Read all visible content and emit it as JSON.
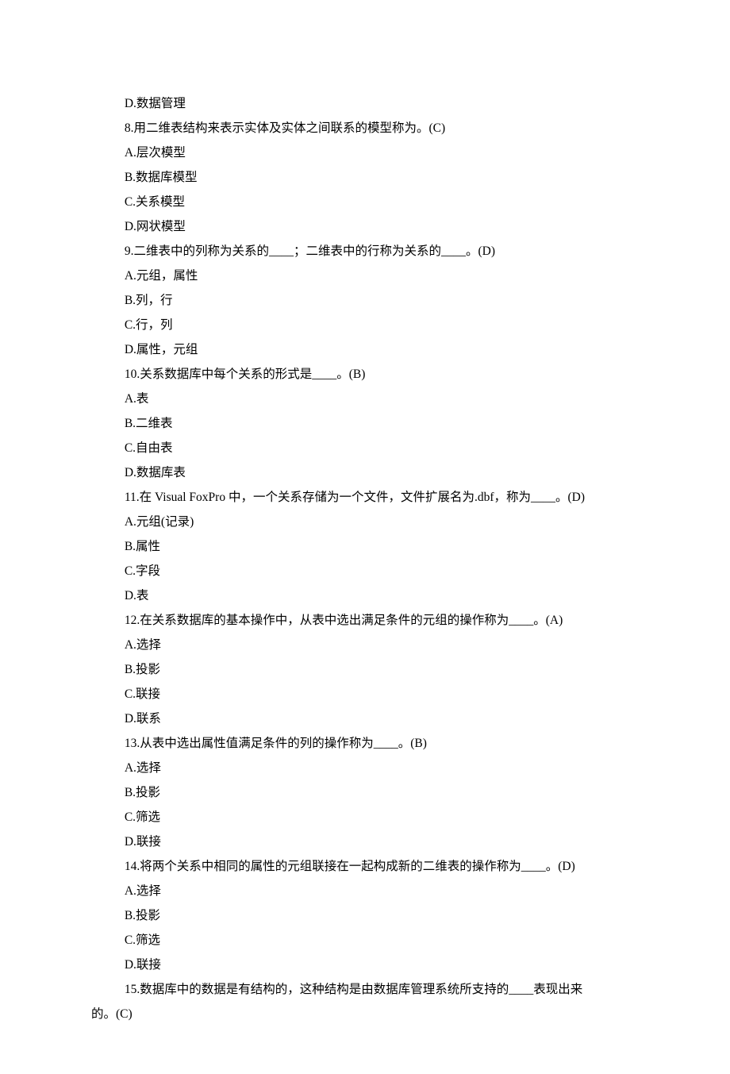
{
  "lines": [
    {
      "text": "D.数据管理",
      "cls": "option-line"
    },
    {
      "text": "8.用二维表结构来表示实体及实体之间联系的模型称为。(C)",
      "cls": "question-line"
    },
    {
      "text": "A.层次模型",
      "cls": "option-line"
    },
    {
      "text": "B.数据库模型",
      "cls": "option-line"
    },
    {
      "text": "C.关系模型",
      "cls": "option-line"
    },
    {
      "text": "D.网状模型",
      "cls": "option-line"
    },
    {
      "text": "9.二维表中的列称为关系的____；二维表中的行称为关系的____。(D)",
      "cls": "question-line"
    },
    {
      "text": "A.元组，属性",
      "cls": "option-line"
    },
    {
      "text": "B.列，行",
      "cls": "option-line"
    },
    {
      "text": "C.行，列",
      "cls": "option-line"
    },
    {
      "text": "D.属性，元组",
      "cls": "option-line"
    },
    {
      "text": "10.关系数据库中每个关系的形式是____。(B)",
      "cls": "question-line"
    },
    {
      "text": "A.表",
      "cls": "option-line"
    },
    {
      "text": "B.二维表",
      "cls": "option-line"
    },
    {
      "text": "C.自由表",
      "cls": "option-line"
    },
    {
      "text": "D.数据库表",
      "cls": "option-line"
    },
    {
      "text": "11.在 Visual FoxPro 中，一个关系存储为一个文件，文件扩展名为.dbf，称为____。(D)",
      "cls": "question-line"
    },
    {
      "text": "A.元组(记录)",
      "cls": "option-line"
    },
    {
      "text": "B.属性",
      "cls": "option-line"
    },
    {
      "text": "C.字段",
      "cls": "option-line"
    },
    {
      "text": "D.表",
      "cls": "option-line"
    },
    {
      "text": "12.在关系数据库的基本操作中，从表中选出满足条件的元组的操作称为____。(A)",
      "cls": "question-line"
    },
    {
      "text": "A.选择",
      "cls": "option-line"
    },
    {
      "text": "B.投影",
      "cls": "option-line"
    },
    {
      "text": "C.联接",
      "cls": "option-line"
    },
    {
      "text": "D.联系",
      "cls": "option-line"
    },
    {
      "text": "13.从表中选出属性值满足条件的列的操作称为____。(B)",
      "cls": "question-line"
    },
    {
      "text": "A.选择",
      "cls": "option-line"
    },
    {
      "text": "B.投影",
      "cls": "option-line"
    },
    {
      "text": "C.筛选",
      "cls": "option-line"
    },
    {
      "text": "D.联接",
      "cls": "option-line"
    },
    {
      "text": "14.将两个关系中相同的属性的元组联接在一起构成新的二维表的操作称为____。(D)",
      "cls": "question-line"
    },
    {
      "text": "A.选择",
      "cls": "option-line"
    },
    {
      "text": "B.投影",
      "cls": "option-line"
    },
    {
      "text": "C.筛选",
      "cls": "option-line"
    },
    {
      "text": "D.联接",
      "cls": "option-line"
    },
    {
      "text": "15.数据库中的数据是有结构的，这种结构是由数据库管理系统所支持的____表现出来",
      "cls": "question-line"
    },
    {
      "text": "的。(C)",
      "cls": "wrap-line"
    }
  ]
}
